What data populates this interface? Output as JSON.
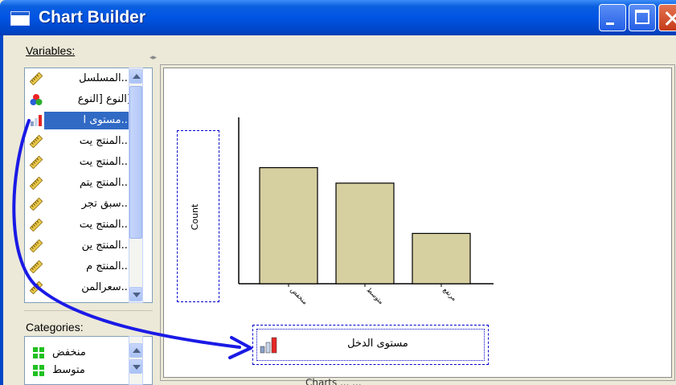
{
  "window": {
    "title": "Chart Builder"
  },
  "variables_panel": {
    "label": "Variables:",
    "items": [
      {
        "label": "...المسلسل",
        "icon": "ruler-scale-icon"
      },
      {
        "label": "[النوع [النوع",
        "icon": "nominal-circles-icon"
      },
      {
        "label": "...مستوى ا",
        "icon": "ordinal-bars-icon",
        "selected": true
      },
      {
        "label": "...المنتج يت",
        "icon": "ruler-scale-icon"
      },
      {
        "label": "...المنتج يت",
        "icon": "ruler-scale-icon"
      },
      {
        "label": "...المنتج يتم",
        "icon": "ruler-scale-icon"
      },
      {
        "label": "...سبق تجر",
        "icon": "ruler-scale-icon"
      },
      {
        "label": "...المنتج يت",
        "icon": "ruler-scale-icon"
      },
      {
        "label": "...المنتج ين",
        "icon": "ruler-scale-icon"
      },
      {
        "label": "...المنتج م",
        "icon": "ruler-scale-icon"
      },
      {
        "label": "...سعرالمن",
        "icon": "ruler-scale-icon"
      }
    ]
  },
  "categories_panel": {
    "label": "Categories:",
    "items": [
      {
        "label": "منخفض",
        "icon": "category-grid-icon"
      },
      {
        "label": "متوسط",
        "icon": "category-grid-icon"
      }
    ]
  },
  "canvas": {
    "y_axis_label": "Count",
    "x_axis_variable": "مستوى الدخل",
    "footer_partial": "Charts ... ..."
  },
  "chart_data": {
    "type": "bar",
    "categories": [
      "منخفض",
      "متوسط",
      "مرتفع"
    ],
    "values": [
      3,
      2.6,
      1.3
    ],
    "ylabel": "Count",
    "xlabel": "مستوى الدخل",
    "bar_color": "#d6cfa0",
    "ylim": [
      0,
      4.3
    ]
  },
  "colors": {
    "titlebar": "#0054e3",
    "selection": "#316ac5",
    "drop_zone_border": "#0000cc",
    "drag_arrow": "#1a1ae6"
  }
}
